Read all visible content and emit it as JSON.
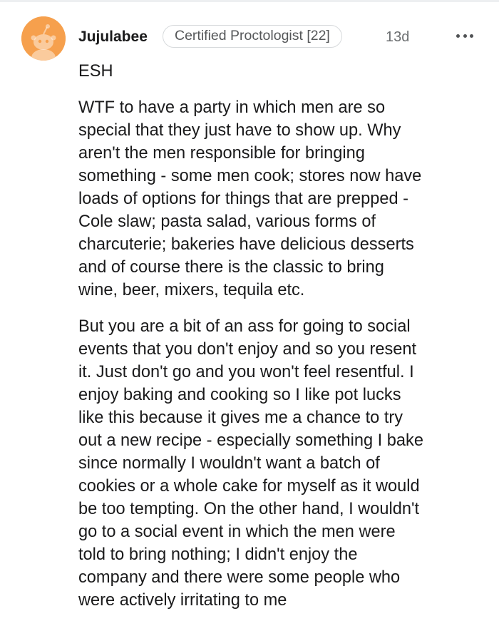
{
  "comment": {
    "username": "Jujulabee",
    "flair": "Certified Proctologist [22]",
    "age": "13d",
    "more_icon": "more-horizontal-icon",
    "avatar_color": "#f6a04d",
    "paragraphs": [
      {
        "lines": [
          "ESH"
        ]
      },
      {
        "lines": [
          "WTF to have a party in which men are so",
          "special that they just have to show up. Why",
          "aren't the men responsible for bringing",
          "something - some men cook; stores now have",
          "loads of options for things that are prepped -",
          "Cole slaw; pasta salad, various forms of",
          "charcuterie; bakeries have delicious desserts",
          "and of course there is the classic to bring",
          "wine, beer, mixers, tequila etc."
        ]
      },
      {
        "lines": [
          "But you are a bit of an ass for going to social",
          "events that you don't enjoy and so you resent",
          "it. Just don't go and you won't feel resentful. I",
          "enjoy baking and cooking so I like pot lucks",
          "like this because it gives me a chance to try",
          "out a new recipe - especially something I bake",
          "since normally I wouldn't want a batch of",
          "cookies or a whole cake for myself as it would",
          "be too tempting. On the other hand, I wouldn't",
          "go to a social event in which the men were",
          "told to bring nothing; I didn't enjoy the",
          "company and there were some people who",
          "were actively irritating to me"
        ]
      }
    ]
  }
}
